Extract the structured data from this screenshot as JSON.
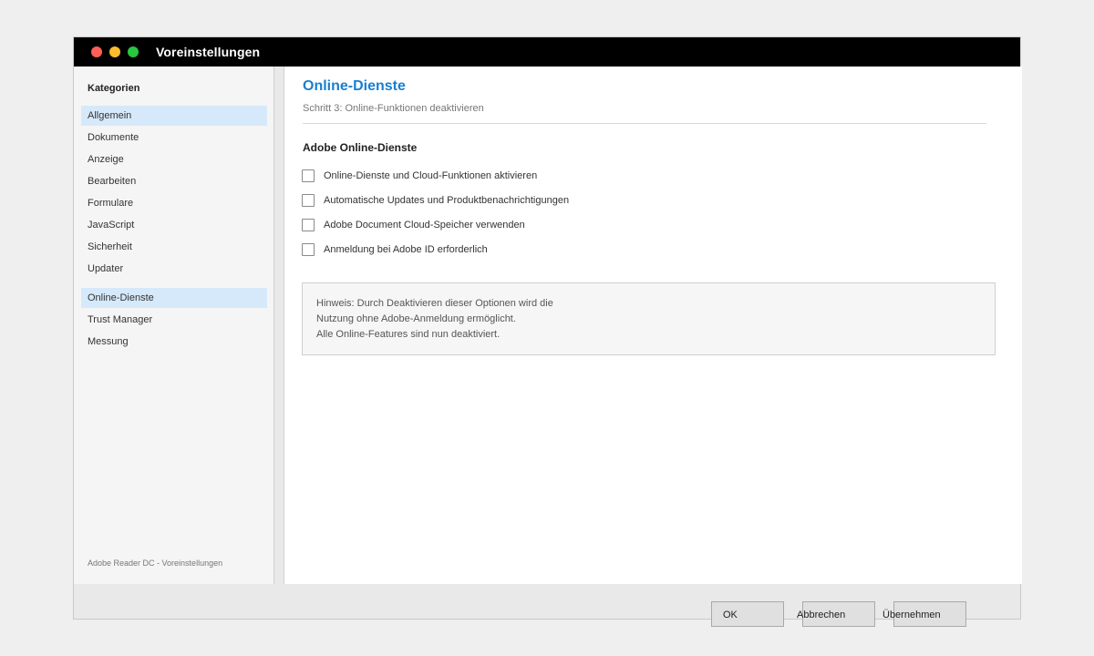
{
  "window": {
    "title": "Voreinstellungen"
  },
  "sidebar": {
    "heading": "Kategorien",
    "items": [
      {
        "label": "Allgemein",
        "active": true
      },
      {
        "label": "Dokumente"
      },
      {
        "label": "Anzeige"
      },
      {
        "label": "Bearbeiten"
      },
      {
        "label": "Formulare"
      },
      {
        "label": "JavaScript"
      },
      {
        "label": "Sicherheit"
      },
      {
        "label": "Updater"
      },
      {
        "label": "Online-Dienste",
        "active": true
      },
      {
        "label": "Trust Manager"
      },
      {
        "label": "Messung"
      }
    ],
    "footer": "Adobe Reader DC - Voreinstellungen"
  },
  "main": {
    "title": "Online-Dienste",
    "subtitle": "Schritt 3: Online-Funktionen deaktivieren",
    "section_title": "Adobe Online-Dienste",
    "options": [
      {
        "label": "Online-Dienste und Cloud-Funktionen aktivieren",
        "checked": false
      },
      {
        "label": "Automatische Updates und Produktbenachrichtigungen",
        "checked": false
      },
      {
        "label": "Adobe Document Cloud-Speicher verwenden",
        "checked": false
      },
      {
        "label": "Anmeldung bei Adobe ID erforderlich",
        "checked": false
      }
    ],
    "note_lines": [
      "Hinweis: Durch Deaktivieren dieser Optionen wird die",
      "Nutzung ohne Adobe-Anmeldung ermöglicht.",
      "Alle Online-Features sind nun deaktiviert."
    ]
  },
  "buttons": {
    "ok": "OK",
    "cancel": "Abbrechen",
    "apply": "Übernehmen"
  },
  "colors": {
    "accent": "#1a7fd0",
    "selection": "#d6e9fa",
    "titlebar": "#000000"
  }
}
